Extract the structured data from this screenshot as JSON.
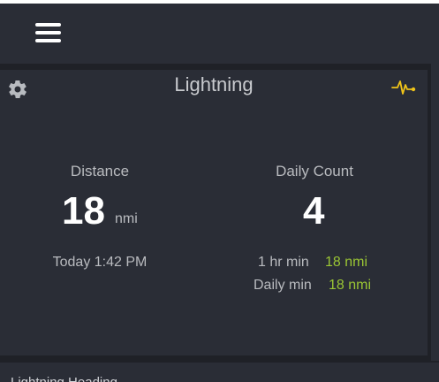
{
  "header": {
    "menu_icon": "hamburger-menu-icon"
  },
  "card": {
    "title": "Lightning",
    "settings_icon": "gear-icon",
    "activity_icon": "pulse-icon",
    "distance": {
      "label": "Distance",
      "value": "18",
      "unit": "nmi",
      "time": "Today 1:42 PM"
    },
    "daily_count": {
      "label": "Daily Count",
      "value": "4",
      "hr_min_label": "1 hr min",
      "hr_min_value": "18 nmi",
      "daily_min_label": "Daily min",
      "daily_min_value": "18 nmi"
    }
  },
  "bottom": {
    "partial_text": "Lightning Heading"
  },
  "colors": {
    "background": "#1f2127",
    "panel": "#2a2d36",
    "accent_green": "#9ac534",
    "accent_yellow": "#f0c419"
  }
}
